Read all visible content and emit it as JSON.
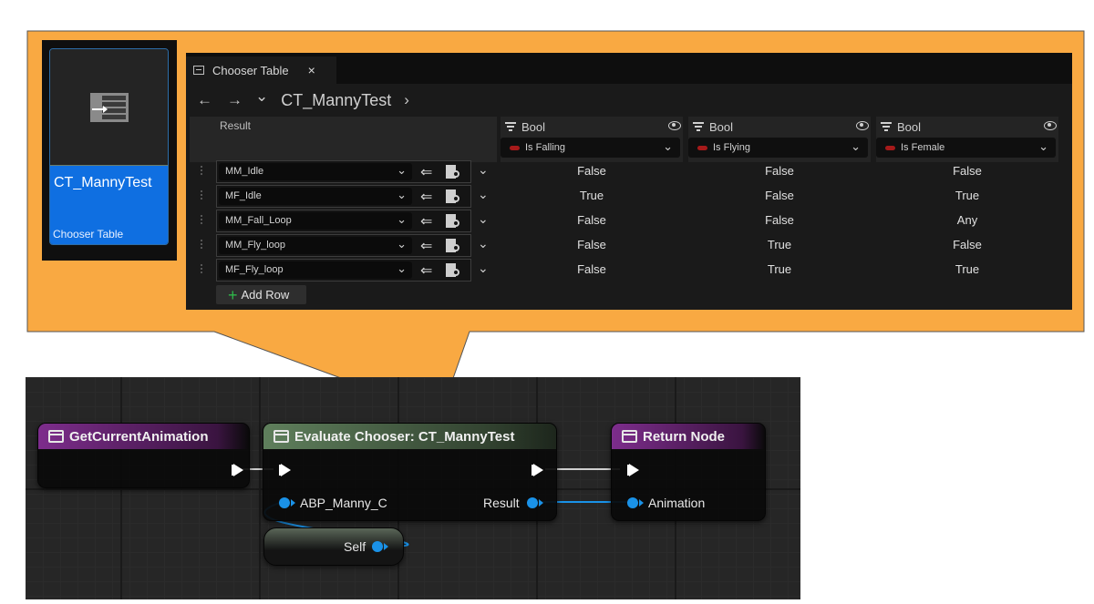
{
  "asset": {
    "name": "CT_MannyTest",
    "type": "Chooser Table",
    "icon": "chooser-table-icon",
    "accent_color": "#0f6fe1"
  },
  "editor": {
    "tab_label": "Chooser Table",
    "tab_close": "×",
    "nav_back": "←",
    "nav_forward": "→",
    "nav_history": "⌄",
    "breadcrumb": "CT_MannyTest",
    "breadcrumb_arrow": "›",
    "result_header": "Result",
    "columns": [
      {
        "type": "Bool",
        "property": "Is Falling"
      },
      {
        "type": "Bool",
        "property": "Is Flying"
      },
      {
        "type": "Bool",
        "property": "Is Female"
      }
    ],
    "rows": [
      {
        "result": "MM_Idle",
        "values": [
          "False",
          "False",
          "False"
        ]
      },
      {
        "result": "MF_Idle",
        "values": [
          "True",
          "False",
          "True"
        ]
      },
      {
        "result": "MM_Fall_Loop",
        "values": [
          "False",
          "False",
          "Any"
        ]
      },
      {
        "result": "MM_Fly_loop",
        "values": [
          "False",
          "True",
          "False"
        ]
      },
      {
        "result": "MF_Fly_loop",
        "values": [
          "False",
          "True",
          "True"
        ]
      }
    ],
    "add_row_label": "Add Row",
    "callout_color": "#f9a942"
  },
  "graph": {
    "nodes": {
      "get_current": {
        "title": "GetCurrentAnimation",
        "color": "#7d2d8c"
      },
      "evaluate": {
        "title": "Evaluate Chooser: CT_MannyTest",
        "color": "#5f7f5c",
        "input_label": "ABP_Manny_C",
        "output_label": "Result"
      },
      "return": {
        "title": "Return Node",
        "color": "#7d2d8c",
        "input_label": "Animation"
      },
      "self": {
        "label": "Self"
      }
    },
    "pin_color": "#1a92e8"
  }
}
